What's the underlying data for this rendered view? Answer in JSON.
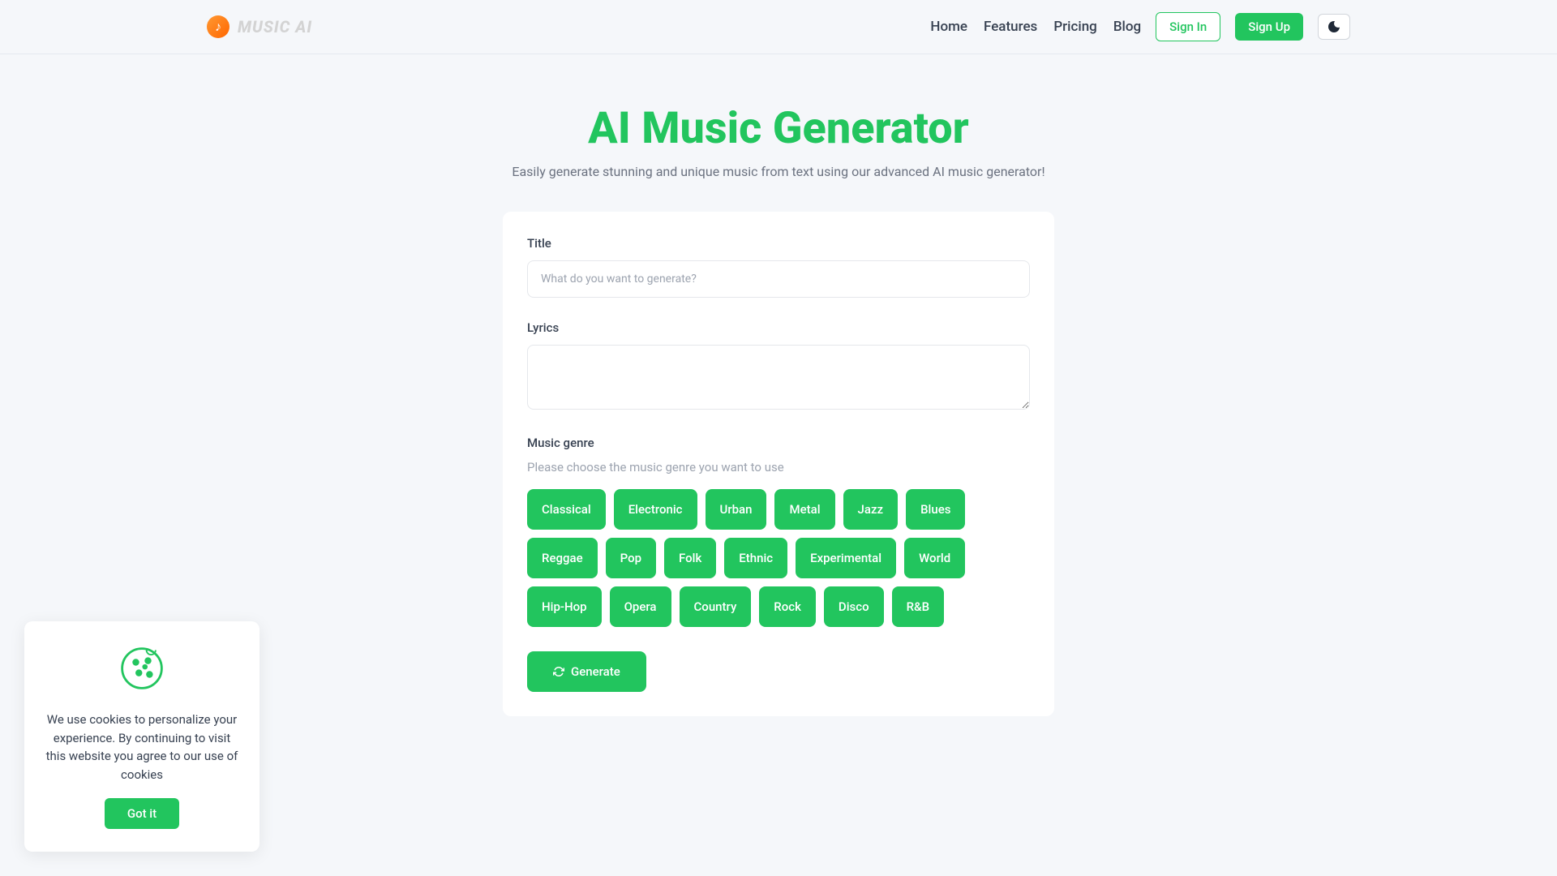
{
  "brand": {
    "name": "MUSIC AI"
  },
  "nav": {
    "links": [
      {
        "label": "Home"
      },
      {
        "label": "Features"
      },
      {
        "label": "Pricing"
      },
      {
        "label": "Blog"
      }
    ],
    "signin": "Sign In",
    "signup": "Sign Up"
  },
  "hero": {
    "title": "AI Music Generator",
    "subtitle": "Easily generate stunning and unique music from text using our advanced AI music generator!"
  },
  "form": {
    "title_label": "Title",
    "title_placeholder": "What do you want to generate?",
    "title_value": "",
    "lyrics_label": "Lyrics",
    "lyrics_value": "",
    "genre_label": "Music genre",
    "genre_hint": "Please choose the music genre you want to use",
    "genres": [
      "Classical",
      "Electronic",
      "Urban",
      "Metal",
      "Jazz",
      "Blues",
      "Reggae",
      "Pop",
      "Folk",
      "Ethnic",
      "Experimental",
      "World",
      "Hip-Hop",
      "Opera",
      "Country",
      "Rock",
      "Disco",
      "R&B"
    ],
    "generate_label": "Generate"
  },
  "cookie": {
    "text": "We use cookies to personalize your experience. By continuing to visit this website you agree to our use of cookies",
    "button": "Got it"
  }
}
